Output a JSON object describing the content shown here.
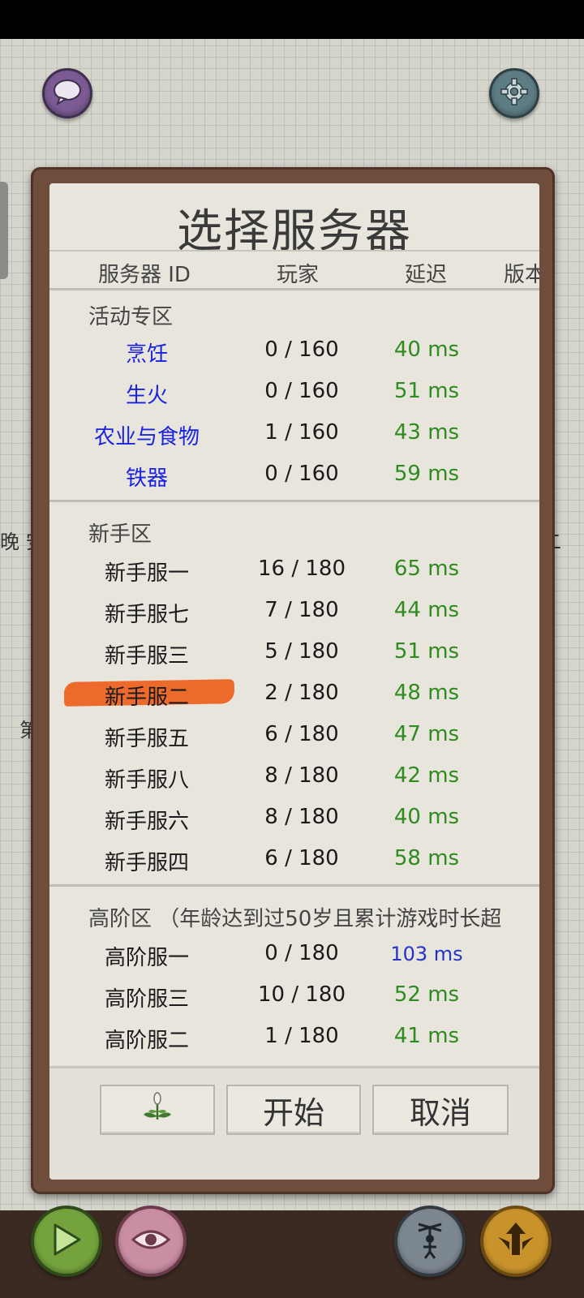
{
  "dialog": {
    "title": "选择服务器",
    "columns": [
      "服务器 ID",
      "玩家",
      "延迟",
      "版本"
    ],
    "sections": [
      {
        "label": "活动专区",
        "servers": [
          {
            "name": "烹饪",
            "players": "0 / 160",
            "ping": "40 ms"
          },
          {
            "name": "生火",
            "players": "0 / 160",
            "ping": "51 ms"
          },
          {
            "name": "农业与食物",
            "players": "1 / 160",
            "ping": "43 ms"
          },
          {
            "name": "铁器",
            "players": "0 / 160",
            "ping": "59 ms"
          }
        ]
      },
      {
        "label": "新手区",
        "servers": [
          {
            "name": "新手服一",
            "players": "16 / 180",
            "ping": "65 ms"
          },
          {
            "name": "新手服七",
            "players": "7 / 180",
            "ping": "44 ms"
          },
          {
            "name": "新手服三",
            "players": "5 / 180",
            "ping": "51 ms"
          },
          {
            "name": "新手服二",
            "players": "2 / 180",
            "ping": "48 ms",
            "selected": true
          },
          {
            "name": "新手服五",
            "players": "6 / 180",
            "ping": "47 ms"
          },
          {
            "name": "新手服八",
            "players": "8 / 180",
            "ping": "42 ms"
          },
          {
            "name": "新手服六",
            "players": "8 / 180",
            "ping": "40 ms"
          },
          {
            "name": "新手服四",
            "players": "6 / 180",
            "ping": "58 ms"
          }
        ]
      },
      {
        "label": "高阶区 （年龄达到过50岁且累计游戏时长超",
        "servers": [
          {
            "name": "高阶服一",
            "players": "0 / 180",
            "ping": "103 ms"
          },
          {
            "name": "高阶服三",
            "players": "10 / 180",
            "ping": "52 ms"
          },
          {
            "name": "高阶服二",
            "players": "1 / 180",
            "ping": "41 ms"
          }
        ]
      }
    ],
    "buttons": {
      "plant_icon": "plant-icon",
      "start": "开始",
      "cancel": "取消"
    }
  },
  "background": {
    "left_text": "晚 安",
    "left_text_2": "第",
    "right_text": "二"
  },
  "colors": {
    "event_server_name": "#1a22e0",
    "ping_good": "#2e8b1f",
    "ping_slow": "#2432c8",
    "selected_highlight": "#ec6a2c",
    "frame": "#6e4d3c"
  }
}
